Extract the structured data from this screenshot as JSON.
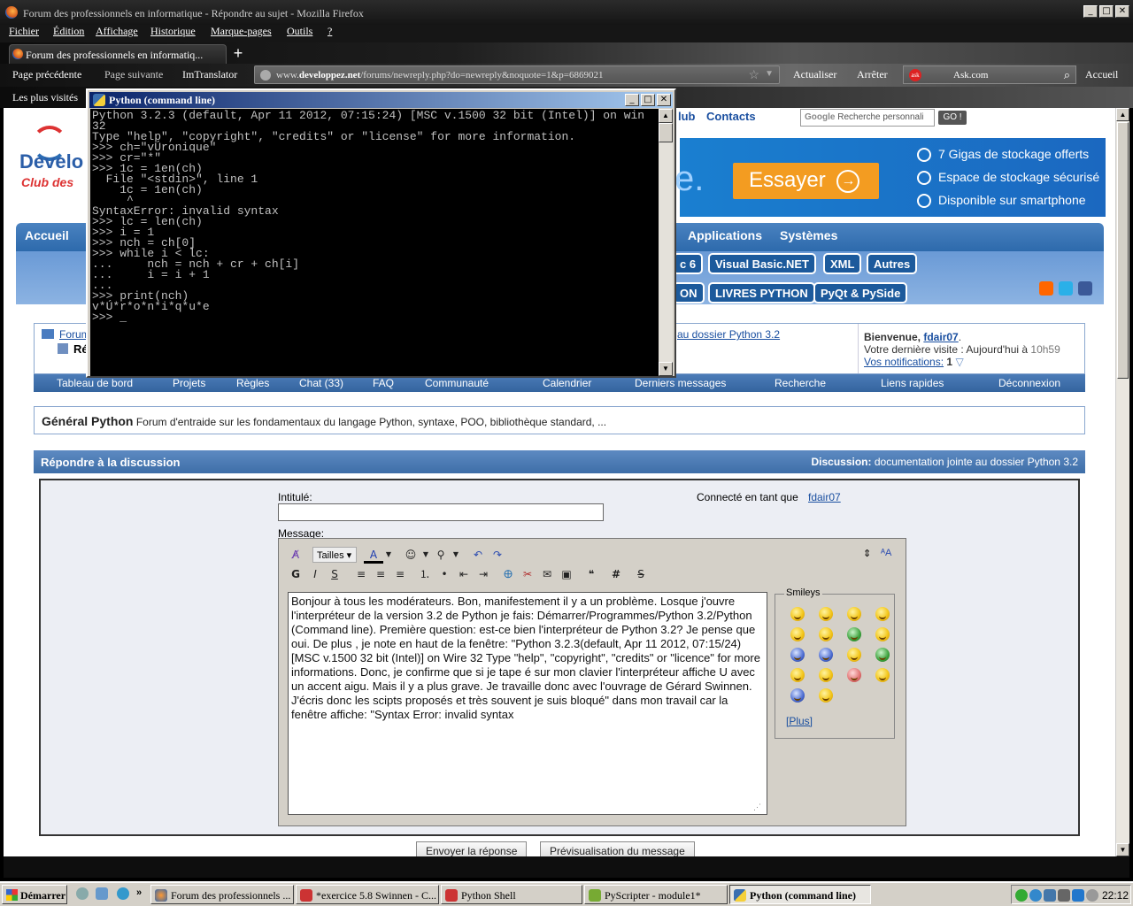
{
  "window": {
    "title": "Forum des professionnels en informatique - Répondre au sujet - Mozilla Firefox"
  },
  "menu": [
    "Fichier",
    "Édition",
    "Affichage",
    "Historique",
    "Marque-pages",
    "Outils",
    "?"
  ],
  "tab": {
    "title": "Forum des professionnels en informatiq...",
    "new": "+"
  },
  "nav": {
    "back": "Page précédente",
    "forward": "Page suivante",
    "translator": "ImTranslator",
    "url_domain": "developpez.net",
    "url_prefix": "www.",
    "url_path": "/forums/newreply.php?do=newreply&noquote=1&p=6869021",
    "refresh": "Actualiser",
    "stop": "Arrêter",
    "search": "Ask.com",
    "home": "Accueil"
  },
  "bookmarks": {
    "most_visited": "Les plus visités"
  },
  "site": {
    "top_links": [
      "lub",
      "Contacts"
    ],
    "google_placeholder": "Recherche personnali",
    "go": "GO !",
    "logo_text": "Develo",
    "logo_sub": "Club des",
    "banner": {
      "big": "e.",
      "cta": "Essayer",
      "items": [
        "7 Gigas de stockage offerts",
        "Espace de stockage sécurisé",
        "Disponible sur smartphone"
      ]
    },
    "nav": [
      "Accueil",
      "Applications",
      "Systèmes"
    ],
    "pills": [
      "c 6",
      "Visual Basic.NET",
      "XML",
      "Autres"
    ],
    "pills2": [
      "ON",
      "LIVRES PYTHON",
      "PyQt & PySide"
    ],
    "crumbs": [
      "Forum",
      "Ré"
    ],
    "crumb_link": "au dossier Python 3.2",
    "welcome": {
      "prefix": "Bienvenue, ",
      "user": "fdair07",
      "last_visit": "Votre dernière visite : Aujourd'hui à ",
      "time": "10h59",
      "notif": "Vos notifications:",
      "notif_count": "1"
    },
    "menu": [
      "Tableau de bord",
      "Projets",
      "Règles",
      "Chat (33)",
      "FAQ",
      "Communauté",
      "Calendrier",
      "Derniers messages",
      "Recherche",
      "Liens rapides",
      "Déconnexion"
    ],
    "forum": {
      "name": "Général Python",
      "desc": "Forum d'entraide sur les fondamentaux du langage Python, syntaxe, POO, bibliothèque standard, ..."
    },
    "reply": {
      "title": "Répondre à la discussion",
      "disc_label": "Discussion:",
      "disc_value": "documentation jointe au dossier Python 3.2"
    },
    "form": {
      "title_label": "Intitulé:",
      "title_value": "",
      "connected": "Connecté en tant que",
      "user": "fdair07",
      "message_label": "Message:",
      "sizes": "Tailles",
      "bold": "G",
      "italic": "I",
      "underline": "S",
      "smileys_label": "Smileys",
      "more": "[Plus]",
      "message": "Bonjour à tous les modérateurs. Bon, manifestement il y a un problème. Losque j'ouvre l'interpréteur de la version 3.2 de Python je fais: Démarrer/Programmes/Python 3.2/Python (Command line).\n Première question: est-ce bien l'interpréteur de Python 3.2?\nJe pense que oui. De plus , je note en haut de la fenêtre: \"Python 3.2.3(default, Apr 11 2012, 07:15/24) [MSC v.1500 32 bit (Intel)] on Wire 32 Type \"help\", \"copyright\", \"credits\" or \"licence\" for more informations. Donc, je confirme que si je tape é sur mon clavier l'interpréteur affiche U avec un accent aigu. Mais il y a plus grave. Je travaille donc avec l'ouvrage de Gérard Swinnen. J'écris donc les scipts proposés et très souvent je suis bloqué\" dans mon travail car la fenêtre affiche: \"Syntax Error: invalid syntax"
    },
    "buttons": {
      "send": "Envoyer la réponse",
      "preview": "Prévisualisation du message"
    }
  },
  "console": {
    "title": "Python (command line)",
    "text": "Python 3.2.3 (default, Apr 11 2012, 07:15:24) [MSC v.1500 32 bit (Intel)] on win\n32\nType \"help\", \"copyright\", \"credits\" or \"license\" for more information.\n>>> ch=\"vÚronique\"\n>>> cr=\"*\"\n>>> 1c = 1en(ch)\n  File \"<stdin>\", line 1\n    1c = 1en(ch)\n     ^\nSyntaxError: invalid syntax\n>>> lc = len(ch)\n>>> i = 1\n>>> nch = ch[0]\n>>> while i < lc:\n...     nch = nch + cr + ch[i]\n...     i = i + 1\n...\n>>> print(nch)\nv*Ú*r*o*n*i*q*u*e\n>>> _"
  },
  "taskbar": {
    "start": "Démarrer",
    "tasks": [
      "Forum des professionnels ...",
      "*exercice 5.8 Swinnen - C...",
      "Python Shell",
      "PyScripter - module1*",
      "Python (command line)"
    ],
    "clock": "22:12"
  },
  "colors": {
    "accent": "#2d6aac",
    "banner": "#1a7fd0",
    "cta": "#f39c21"
  }
}
